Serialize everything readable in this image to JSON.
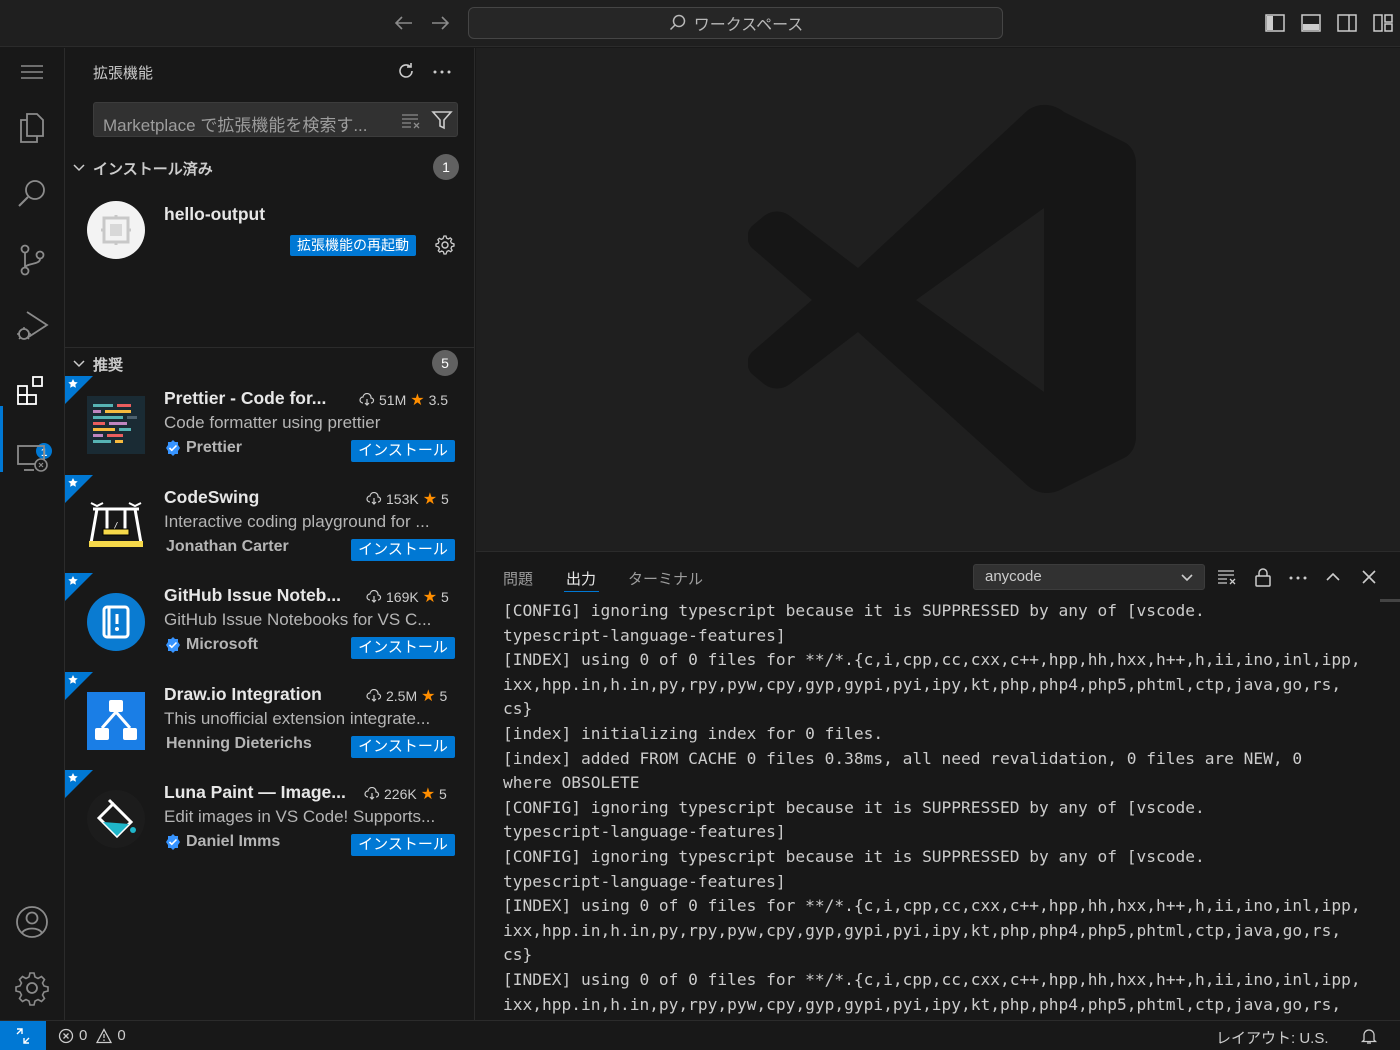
{
  "titlebar": {
    "search_text": "ワークスペース"
  },
  "sidebar": {
    "title": "拡張機能",
    "search_placeholder": "Marketplace で拡張機能を検索す...",
    "installed": {
      "label": "インストール済み",
      "count": "1",
      "items": [
        {
          "name": "hello-output",
          "action_label": "拡張機能の再起動"
        }
      ]
    },
    "recommended": {
      "label": "推奨",
      "count": "5",
      "items": [
        {
          "name": "Prettier - Code for...",
          "description": "Code formatter using prettier",
          "publisher": "Prettier",
          "verified": true,
          "downloads": "51M",
          "rating": "3.5",
          "install_label": "インストール"
        },
        {
          "name": "CodeSwing",
          "description": "Interactive coding playground for ...",
          "publisher": "Jonathan Carter",
          "verified": false,
          "downloads": "153K",
          "rating": "5",
          "install_label": "インストール"
        },
        {
          "name": "GitHub Issue Noteb...",
          "description": "GitHub Issue Notebooks for VS C...",
          "publisher": "Microsoft",
          "verified": true,
          "downloads": "169K",
          "rating": "5",
          "install_label": "インストール"
        },
        {
          "name": "Draw.io Integration",
          "description": "This unofficial extension integrate...",
          "publisher": "Henning Dieterichs",
          "verified": false,
          "downloads": "2.5M",
          "rating": "5",
          "install_label": "インストール"
        },
        {
          "name": "Luna Paint — Image...",
          "description": "Edit images in VS Code! Supports...",
          "publisher": "Daniel Imms",
          "verified": true,
          "downloads": "226K",
          "rating": "5",
          "install_label": "インストール"
        }
      ]
    }
  },
  "activitybar": {
    "extensions_badge": "1"
  },
  "panel": {
    "tabs": [
      "問題",
      "出力",
      "ターミナル"
    ],
    "active_tab": "出力",
    "channel": "anycode",
    "output_lines": [
      "[CONFIG] ignoring typescript because it is SUPPRESSED by any of [vscode.",
      "typescript-language-features]",
      "[INDEX] using 0 of 0 files for **/*.{c,i,cpp,cc,cxx,c++,hpp,hh,hxx,h++,h,ii,ino,inl,ipp,",
      "ixx,hpp.in,h.in,py,rpy,pyw,cpy,gyp,gypi,pyi,ipy,kt,php,php4,php5,phtml,ctp,java,go,rs,",
      "cs}",
      "[index] initializing index for 0 files.",
      "[index] added FROM CACHE 0 files 0.38ms, all need revalidation, 0 files are NEW, 0",
      "where OBSOLETE",
      "[CONFIG] ignoring typescript because it is SUPPRESSED by any of [vscode.",
      "typescript-language-features]",
      "[CONFIG] ignoring typescript because it is SUPPRESSED by any of [vscode.",
      "typescript-language-features]",
      "[INDEX] using 0 of 0 files for **/*.{c,i,cpp,cc,cxx,c++,hpp,hh,hxx,h++,h,ii,ino,inl,ipp,",
      "ixx,hpp.in,h.in,py,rpy,pyw,cpy,gyp,gypi,pyi,ipy,kt,php,php4,php5,phtml,ctp,java,go,rs,",
      "cs}",
      "[INDEX] using 0 of 0 files for **/*.{c,i,cpp,cc,cxx,c++,hpp,hh,hxx,h++,h,ii,ino,inl,ipp,",
      "ixx,hpp.in,h.in,py,rpy,pyw,cpy,gyp,gypi,pyi,ipy,kt,php,php4,php5,phtml,ctp,java,go,rs,"
    ]
  },
  "statusbar": {
    "errors": "0",
    "warnings": "0",
    "layout": "レイアウト: U.S."
  },
  "colors": {
    "accent": "#0078d4",
    "star": "#ff8e00",
    "background": "#181818",
    "editor_bg": "#1f1f1f"
  }
}
